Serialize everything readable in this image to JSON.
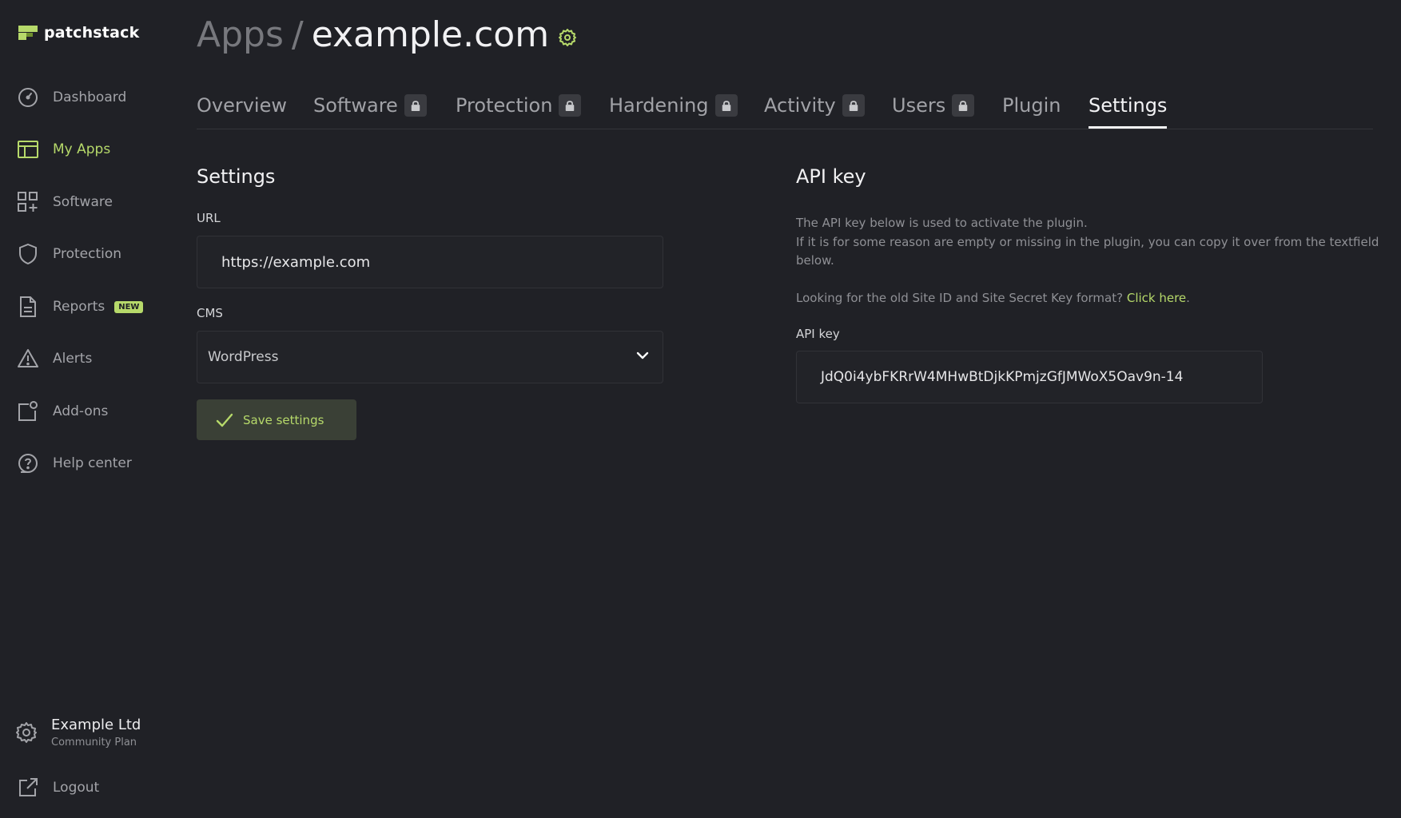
{
  "brand": {
    "name": "patchstack"
  },
  "sidebar": {
    "items": [
      {
        "label": "Dashboard",
        "icon": "dashboard-icon"
      },
      {
        "label": "My Apps",
        "icon": "apps-icon"
      },
      {
        "label": "Software",
        "icon": "software-icon"
      },
      {
        "label": "Protection",
        "icon": "shield-icon"
      },
      {
        "label": "Reports",
        "icon": "report-icon",
        "badge": "NEW"
      },
      {
        "label": "Alerts",
        "icon": "alert-icon"
      },
      {
        "label": "Add-ons",
        "icon": "addons-icon"
      },
      {
        "label": "Help center",
        "icon": "help-icon"
      }
    ],
    "active": "My Apps",
    "account": {
      "name": "Example Ltd",
      "plan": "Community Plan"
    },
    "logout_label": "Logout"
  },
  "header": {
    "parent": "Apps",
    "separator": "/",
    "current": "example.com"
  },
  "tabs": [
    {
      "label": "Overview",
      "locked": false
    },
    {
      "label": "Software",
      "locked": true
    },
    {
      "label": "Protection",
      "locked": true
    },
    {
      "label": "Hardening",
      "locked": true
    },
    {
      "label": "Activity",
      "locked": true
    },
    {
      "label": "Users",
      "locked": true
    },
    {
      "label": "Plugin",
      "locked": false
    },
    {
      "label": "Settings",
      "locked": false
    }
  ],
  "active_tab": "Settings",
  "settings": {
    "title": "Settings",
    "url_label": "URL",
    "url_value": "https://example.com",
    "cms_label": "CMS",
    "cms_value": "WordPress",
    "save_label": "Save settings"
  },
  "api": {
    "title": "API key",
    "desc_line1": "The API key below is used to activate the plugin.",
    "desc_line2": "If it is for some reason are empty or missing in the plugin, you can copy it over from the textfield below.",
    "old_format_text": "Looking for the old Site ID and Site Secret Key format?",
    "old_format_link": "Click here",
    "old_format_end": ".",
    "key_label": "API key",
    "key_value": "JdQ0i4ybFKRrW4MHwBtDjkKPmjzGfJMWoX5Oav9n-14"
  },
  "colors": {
    "accent": "#b6d96a",
    "background": "#202126",
    "muted": "#a3a4a9"
  }
}
